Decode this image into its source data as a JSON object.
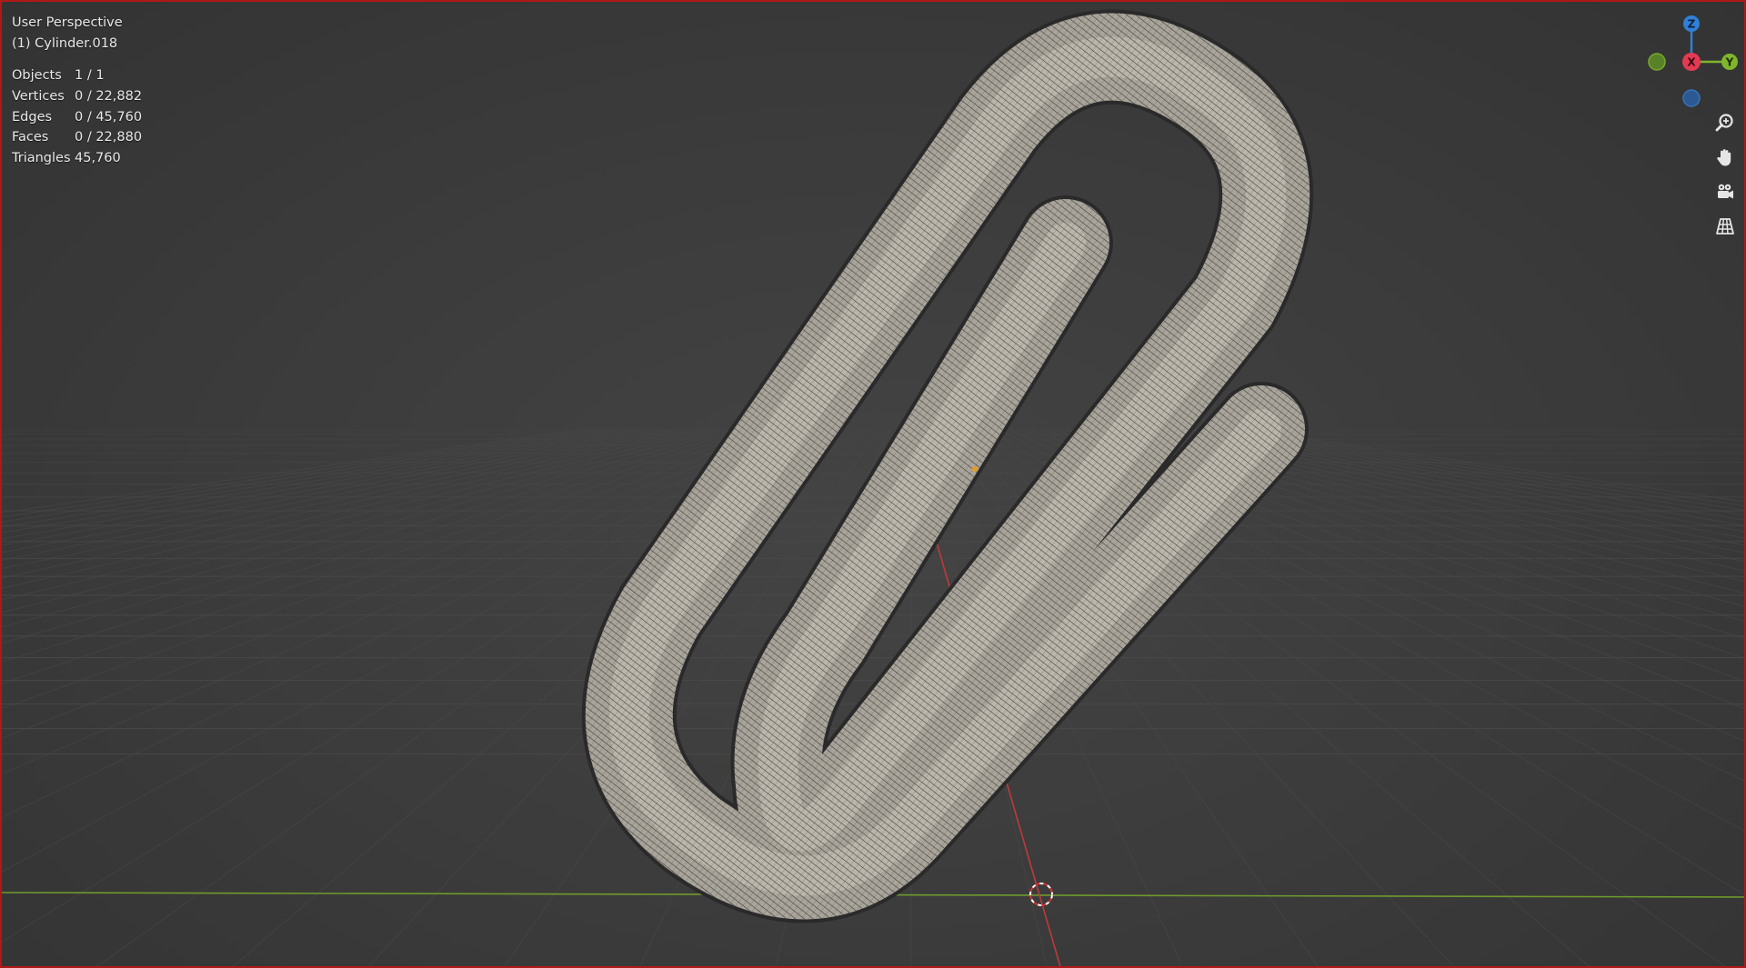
{
  "viewport": {
    "title": "User Perspective",
    "object_name": "(1) Cylinder.018"
  },
  "stats": [
    {
      "label": "Objects",
      "value": "1 / 1"
    },
    {
      "label": "Vertices",
      "value": "0 / 22,882"
    },
    {
      "label": "Edges",
      "value": "0 / 45,760"
    },
    {
      "label": "Faces",
      "value": "0 / 22,880"
    },
    {
      "label": "Triangles",
      "value": "45,760"
    }
  ],
  "gizmo": {
    "x_label": "X",
    "y_label": "Y",
    "z_label": "Z",
    "x_color": "#e43a52",
    "y_color": "#7fb62b",
    "z_color": "#2f80d8",
    "neg_y_color": "#5d8a26",
    "neg_z_color": "#2b5f9e"
  },
  "nav_tools": [
    "zoom-icon",
    "pan-hand-icon",
    "camera-icon",
    "grid-icon"
  ],
  "colors": {
    "viewport_border": "#b01818",
    "background": "#3d3d3d",
    "grid_line": "#4a4a4a",
    "x_axis": "#c03a3a",
    "y_axis": "#6f9a2c",
    "origin_dot": "#e89a1e",
    "mesh_fill": "#a9a49a",
    "wire": "#1d1d1d"
  }
}
